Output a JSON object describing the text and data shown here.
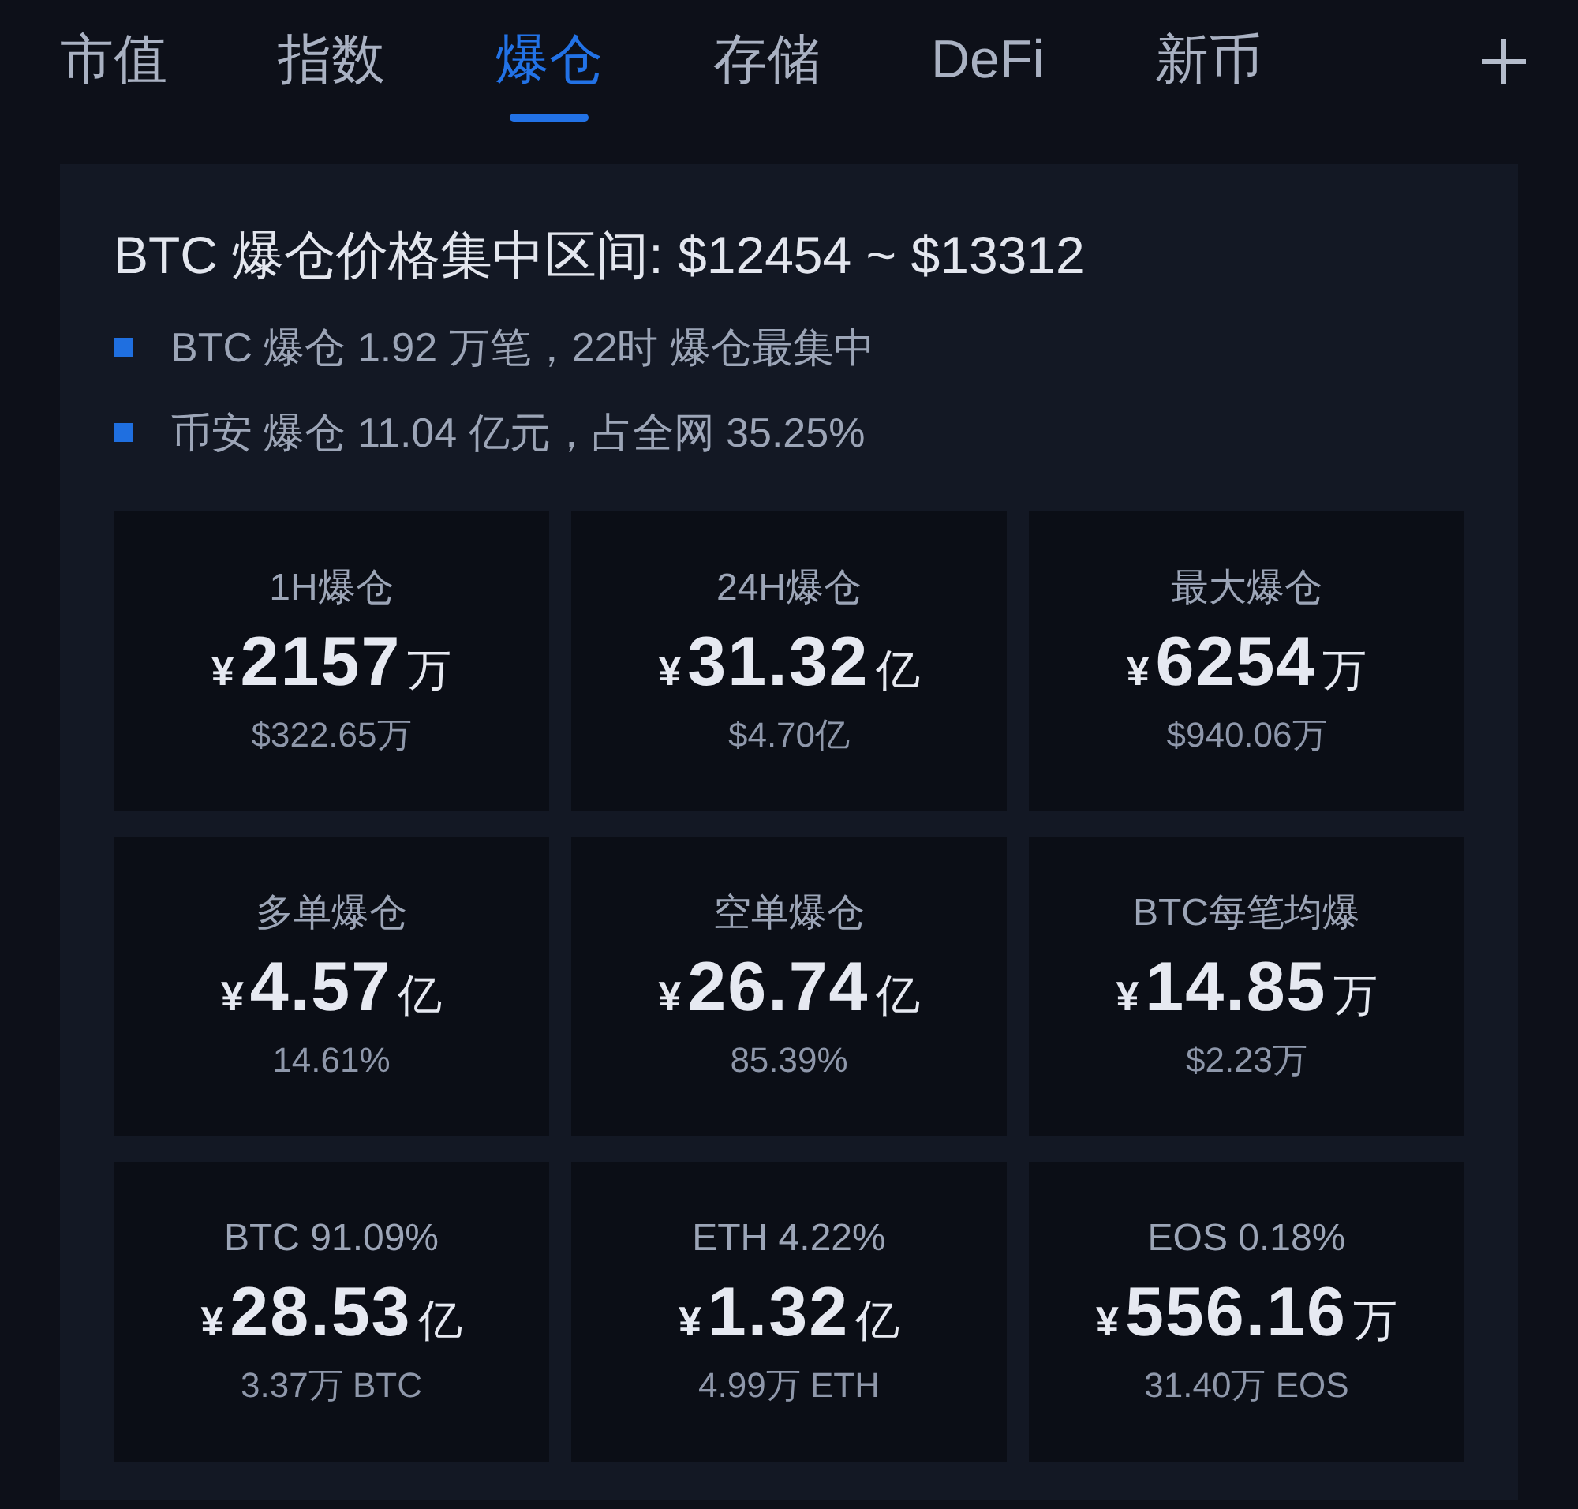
{
  "tabs": [
    {
      "label": "市值",
      "selected": false
    },
    {
      "label": "指数",
      "selected": false
    },
    {
      "label": "爆仓",
      "selected": true
    },
    {
      "label": "存储",
      "selected": false
    },
    {
      "label": "DeFi",
      "selected": false
    },
    {
      "label": "新币",
      "selected": false
    }
  ],
  "panel": {
    "title": "BTC 爆仓价格集中区间: $12454 ~ $13312",
    "bullets": [
      "BTC 爆仓 1.92 万笔，22时 爆仓最集中",
      "币安 爆仓 11.04 亿元，占全网 35.25%"
    ]
  },
  "cards": [
    {
      "label": "1H爆仓",
      "currency": "¥",
      "amount": "2157",
      "unit": "万",
      "sub": "$322.65万"
    },
    {
      "label": "24H爆仓",
      "currency": "¥",
      "amount": "31.32",
      "unit": "亿",
      "sub": "$4.70亿"
    },
    {
      "label": "最大爆仓",
      "currency": "¥",
      "amount": "6254",
      "unit": "万",
      "sub": "$940.06万"
    },
    {
      "label": "多单爆仓",
      "currency": "¥",
      "amount": "4.57",
      "unit": "亿",
      "sub": "14.61%"
    },
    {
      "label": "空单爆仓",
      "currency": "¥",
      "amount": "26.74",
      "unit": "亿",
      "sub": "85.39%"
    },
    {
      "label": "BTC每笔均爆",
      "currency": "¥",
      "amount": "14.85",
      "unit": "万",
      "sub": "$2.23万"
    },
    {
      "label": "BTC 91.09%",
      "currency": "¥",
      "amount": "28.53",
      "unit": "亿",
      "sub": "3.37万 BTC"
    },
    {
      "label": "ETH 4.22%",
      "currency": "¥",
      "amount": "1.32",
      "unit": "亿",
      "sub": "4.99万 ETH"
    },
    {
      "label": "EOS 0.18%",
      "currency": "¥",
      "amount": "556.16",
      "unit": "万",
      "sub": "31.40万 EOS"
    }
  ]
}
